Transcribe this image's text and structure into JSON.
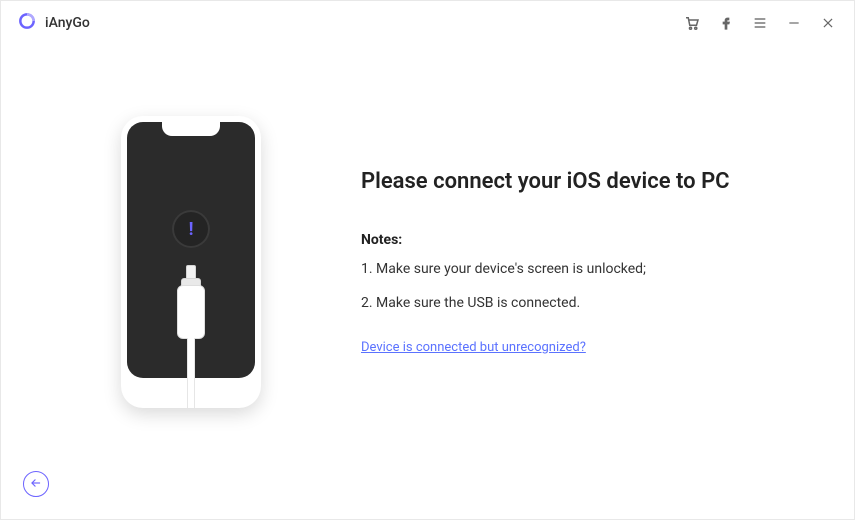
{
  "app": {
    "name": "iAnyGo"
  },
  "main": {
    "title": "Please connect your iOS device to PC",
    "notes_label": "Notes:",
    "notes": [
      "1. Make sure your device's screen is unlocked;",
      "2. Make sure the USB is connected."
    ],
    "help_link": "Device is connected but unrecognized?"
  },
  "icons": {
    "logo": "logo-icon",
    "cart": "cart-icon",
    "facebook": "facebook-icon",
    "menu": "menu-icon",
    "minimize": "minimize-icon",
    "close": "close-icon",
    "alert": "alert-icon",
    "back": "back-arrow-icon"
  }
}
